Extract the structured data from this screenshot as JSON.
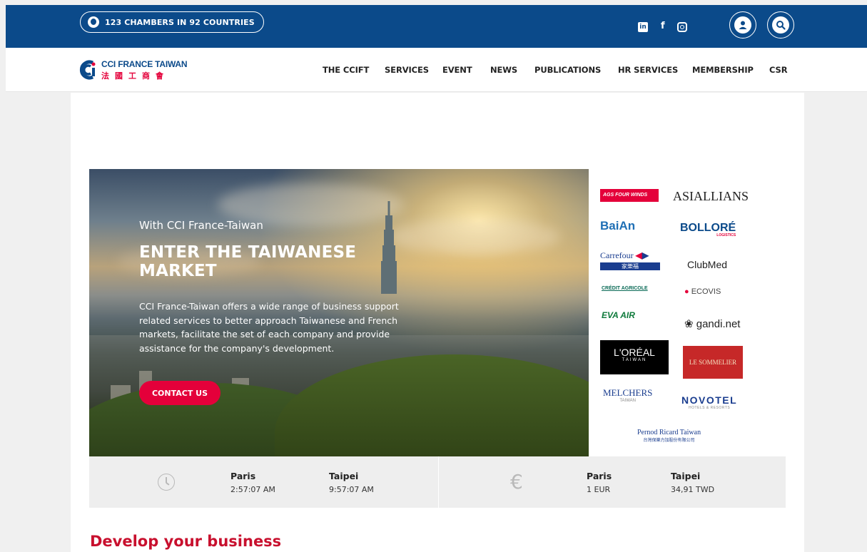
{
  "topbar": {
    "chambers_text": "123 CHAMBERS IN 92 COUNTRIES",
    "social": [
      "linkedin-icon",
      "facebook-icon",
      "instagram-icon"
    ],
    "buttons": [
      "user-icon",
      "search-icon"
    ],
    "color": "#0b4a8a"
  },
  "logo": {
    "line1": "CCI FRANCE TAIWAN",
    "line2": "法國工商會"
  },
  "nav": {
    "items": [
      "THE CCIFT",
      "SERVICES",
      "EVENT",
      "NEWS",
      "PUBLICATIONS",
      "HR SERVICES",
      "MEMBERSHIP",
      "CSR"
    ]
  },
  "hero": {
    "subtitle": "With CCI France-Taiwan",
    "title": "ENTER THE TAIWANESE MARKET",
    "description": "CCI France-Taiwan offers a wide range of business support related services to better approach Taiwanese and French markets, facilitate the set of each company and provide assistance for the company's development.",
    "cta": "CONTACT US",
    "accent": "#e4003a"
  },
  "partners": {
    "agsfourwinds": "AGS FOUR WINDS",
    "asiallians": "ASIALLIANS",
    "baian": "BaiAn",
    "bollore": "BOLLORÉ",
    "bollore_sub": "LOGISTICS",
    "carrefour": "Carrefour",
    "carrefour_cn": "家樂福",
    "clubmed": "ClubMed",
    "creditagricole": "CRÉDIT AGRICOLE",
    "ecovis": "ECOVIS",
    "evaair": "EVA AIR",
    "gandi": "gandi.net",
    "loreal": "L'ORÉAL",
    "loreal_sub": "TAIWAN",
    "sommelier": "LE SOMMELIER",
    "melchers": "MELCHERS",
    "melchers_sub": "TAIWAN",
    "novotel": "NOVOTEL",
    "novotel_sub": "HOTELS & RESORTS",
    "pernod": "Pernod Ricard Taiwan",
    "pernod_cn": "台灣保樂力加股份有限公司"
  },
  "info": {
    "time": [
      {
        "city": "Paris",
        "value": "2:57:07 AM"
      },
      {
        "city": "Taipei",
        "value": "9:57:07 AM"
      }
    ],
    "currency": [
      {
        "city": "Paris",
        "value": "1 EUR"
      },
      {
        "city": "Taipei",
        "value": "34,91 TWD"
      }
    ],
    "icons": [
      "clock-icon",
      "euro-icon"
    ]
  },
  "section": {
    "title": "Develop your business",
    "color": "#c8102e"
  }
}
